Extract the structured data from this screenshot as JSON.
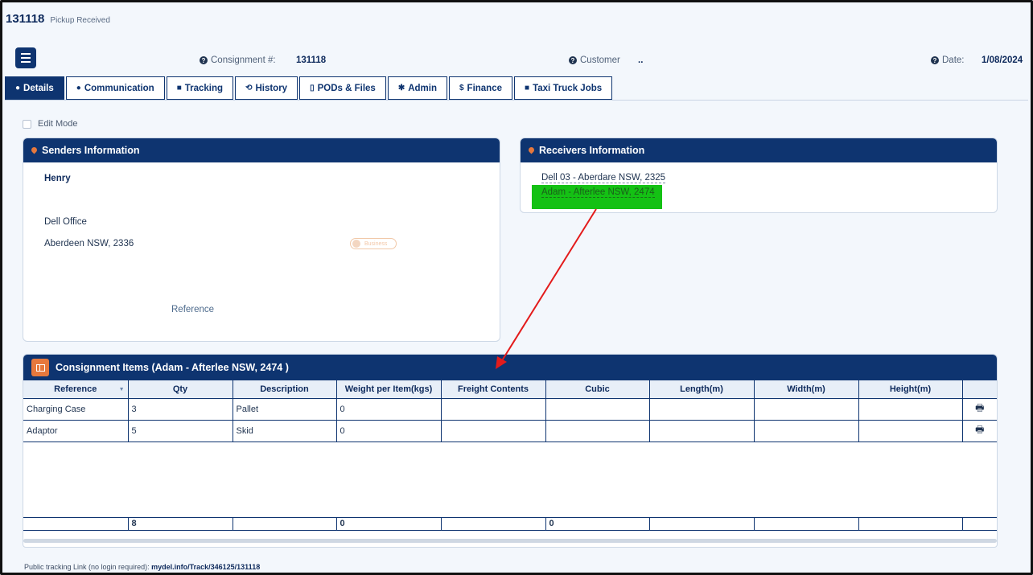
{
  "header": {
    "consignment_id": "131118",
    "status": "Pickup Received"
  },
  "meta": {
    "consignment_label": "Consignment #:",
    "consignment_value": "131118",
    "customer_label": "Customer",
    "customer_value": "..",
    "date_label": "Date:",
    "date_value": "1/08/2024"
  },
  "tabs": [
    {
      "label": "Details",
      "icon": "user-icon"
    },
    {
      "label": "Communication",
      "icon": "chat-icon"
    },
    {
      "label": "Tracking",
      "icon": "truck-icon"
    },
    {
      "label": "History",
      "icon": "history-icon"
    },
    {
      "label": "PODs & Files",
      "icon": "file-icon"
    },
    {
      "label": "Admin",
      "icon": "gear-icon"
    },
    {
      "label": "Finance",
      "icon": "dollar-icon"
    },
    {
      "label": "Taxi Truck Jobs",
      "icon": "truck-icon"
    }
  ],
  "tab_icons": [
    "●",
    "●",
    "■",
    "⟲",
    "▯",
    "✱",
    "$",
    "■"
  ],
  "edit_mode_label": "Edit Mode",
  "senders": {
    "title": "Senders Information",
    "name": "Henry",
    "company": "Dell Office",
    "address": "Aberdeen NSW, 2336",
    "toggle_label": "Business",
    "reference_label": "Reference"
  },
  "receivers": {
    "title": "Receivers Information",
    "line1": "Dell 03 - Aberdare NSW, 2325",
    "line2": "Adam - Afterlee NSW, 2474"
  },
  "items": {
    "title": "Consignment Items (Adam - Afterlee NSW, 2474 )",
    "columns": [
      "Reference",
      "Qty",
      "Description",
      "Weight per Item(kgs)",
      "Freight Contents",
      "Cubic",
      "Length(m)",
      "Width(m)",
      "Height(m)",
      ""
    ],
    "rows": [
      {
        "reference": "Charging Case",
        "qty": "3",
        "description": "Pallet",
        "weight": "0"
      },
      {
        "reference": "Adaptor",
        "qty": "5",
        "description": "Skid",
        "weight": "0"
      }
    ],
    "totals": {
      "qty": "8",
      "weight": "0",
      "cubic": "0"
    }
  },
  "footer": {
    "label": "Public tracking Link (no login required):",
    "link": "mydel.info/Track/346125/131118"
  },
  "colors": {
    "navy": "#0e3470",
    "accent_orange": "#e6783d",
    "highlight_green": "#14c114",
    "arrow_red": "#e31b1b"
  }
}
